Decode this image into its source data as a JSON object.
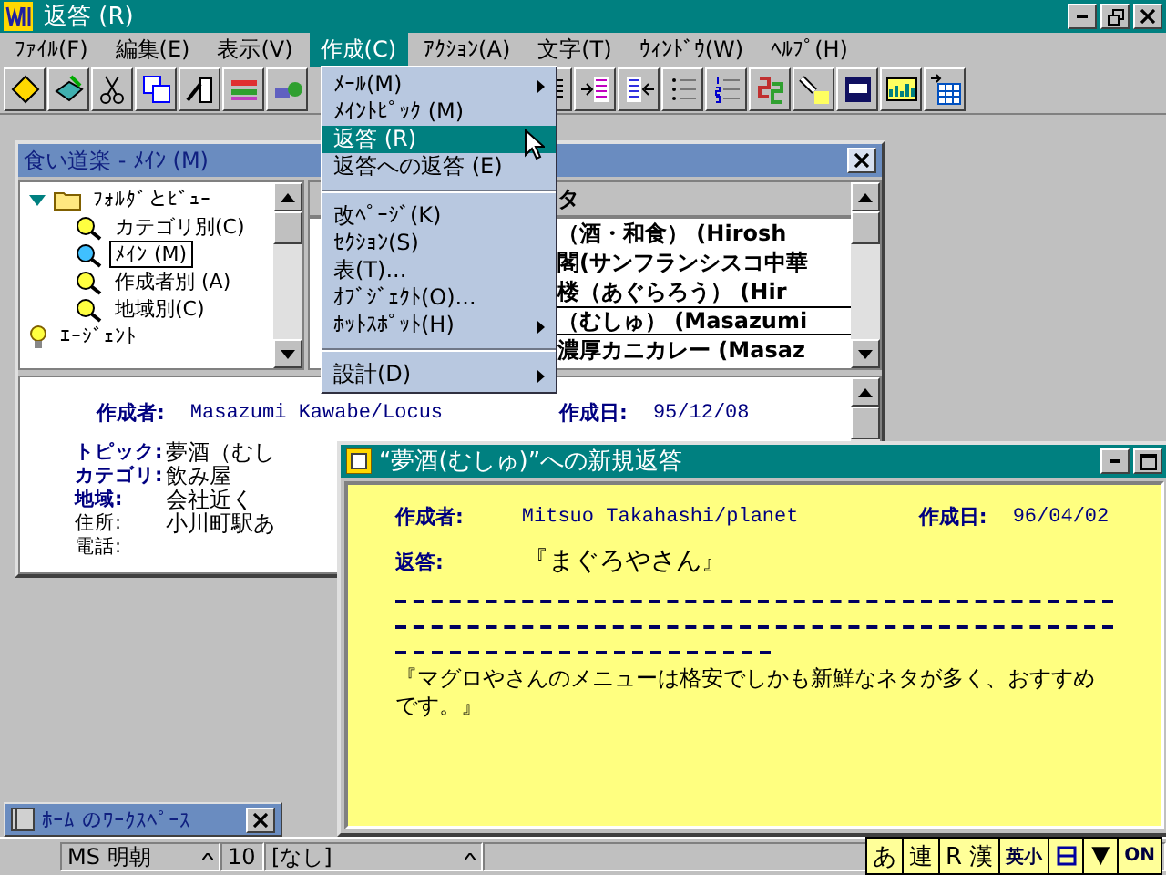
{
  "window": {
    "title": "返答 (R)"
  },
  "menu_bar": [
    {
      "label": "ﾌｧｲﾙ(F)",
      "selected": false
    },
    {
      "label": "編集(E)",
      "selected": false
    },
    {
      "label": "表示(V)",
      "selected": false
    },
    {
      "label": "作成(C)",
      "selected": true
    },
    {
      "label": "ｱｸｼｮﾝ(A)",
      "selected": false
    },
    {
      "label": "文字(T)",
      "selected": false
    },
    {
      "label": "ｳｨﾝﾄﾞｳ(W)",
      "selected": false
    },
    {
      "label": "ﾍﾙﾌﾟ(H)",
      "selected": false
    }
  ],
  "dropdown": [
    {
      "kind": "item",
      "label": "ﾒｰﾙ(M)",
      "submenu": true,
      "selected": false
    },
    {
      "kind": "item",
      "label": "ﾒｲﾝﾄﾋﾟｯｸ (M)",
      "submenu": false,
      "selected": false
    },
    {
      "kind": "item",
      "label": "返答 (R)",
      "submenu": false,
      "selected": true
    },
    {
      "kind": "item",
      "label": "返答への返答 (E)",
      "submenu": false,
      "selected": false
    },
    {
      "kind": "separator"
    },
    {
      "kind": "item",
      "label": "改ﾍﾟｰｼﾞ(K)",
      "submenu": false,
      "selected": false
    },
    {
      "kind": "item",
      "label": "ｾｸｼｮﾝ(S)",
      "submenu": false,
      "selected": false
    },
    {
      "kind": "item",
      "label": "表(T)...",
      "submenu": false,
      "selected": false
    },
    {
      "kind": "item",
      "label": "ｵﾌﾞｼﾞｪｸﾄ(O)...",
      "submenu": false,
      "selected": false
    },
    {
      "kind": "item",
      "label": "ﾎｯﾄｽﾎﾟｯﾄ(H)",
      "submenu": true,
      "selected": false
    },
    {
      "kind": "separator"
    },
    {
      "kind": "item",
      "label": "設計(D)",
      "submenu": true,
      "selected": false
    }
  ],
  "main_window": {
    "title": "食い道楽 - ﾒｲﾝ (M)",
    "tree": [
      {
        "kind": "folder",
        "label": "ﾌｫﾙﾀﾞとﾋﾞｭｰ",
        "expanded": true,
        "selected": false,
        "children": [
          {
            "kind": "view",
            "label": "カテゴリ別(C)",
            "selected": false
          },
          {
            "kind": "view",
            "label": "ﾒｲﾝ (M)",
            "selected": true
          },
          {
            "kind": "view",
            "label": "作成者別 (A)",
            "selected": false
          },
          {
            "kind": "view",
            "label": "地域別(C)",
            "selected": false
          }
        ]
      },
      {
        "kind": "agent",
        "label": "ｴｰｼﾞｪﾝﾄ",
        "selected": false
      }
    ],
    "view": {
      "column_header": "タ",
      "rows": [
        {
          "text": "（酒・和食） (Hirosh",
          "selected": false
        },
        {
          "text": "閣(サンフランシスコ中華",
          "selected": false
        },
        {
          "text": "楼（あぐらろう） (Hir",
          "selected": false
        },
        {
          "text": "（むしゅ） (Masazumi",
          "selected": true
        },
        {
          "text": "濃厚カニカレー (Masaz",
          "selected": false
        }
      ]
    },
    "document": {
      "author_label": "作成者:",
      "author": "Masazumi Kawabe/Locus",
      "date_label": "作成日:",
      "date": "95/12/08",
      "fields": [
        {
          "label": "トピック:",
          "value": "夢酒（むし",
          "bold": true
        },
        {
          "label": "カテゴリ:",
          "value": "飲み屋",
          "bold": true
        },
        {
          "label": "地域:",
          "value": "会社近く",
          "bold": true
        },
        {
          "label": "住所:",
          "value": "小川町駅あ",
          "bold": false
        },
        {
          "label": "電話:",
          "bold": false
        }
      ]
    }
  },
  "reply_window": {
    "title": "“夢酒(むしゅ)”への新規返答",
    "author_label": "作成者:",
    "author": "Mitsuo Takahashi/planet",
    "date_label": "作成日:",
    "date": "96/04/02",
    "reply_label": "返答:",
    "reply_subject": "『まぐろやさん』",
    "body": "『マグロやさんのメニューは格安でしかも新鮮なネタが多く、おすすめです。』"
  },
  "minimized_window": {
    "title": "ﾎｰﾑ のﾜｰｸｽﾍﾟｰｽ"
  },
  "status_bar": {
    "font": "MS 明朝",
    "size": "10",
    "style": "[なし]"
  },
  "ime_bar": [
    {
      "kind": "text",
      "label": "あ"
    },
    {
      "kind": "text",
      "label": "連"
    },
    {
      "kind": "text",
      "label": "R 漢"
    },
    {
      "kind": "small",
      "label": "英小"
    },
    {
      "kind": "box"
    },
    {
      "kind": "text",
      "label": "▼"
    },
    {
      "kind": "small",
      "label": "ON"
    }
  ]
}
